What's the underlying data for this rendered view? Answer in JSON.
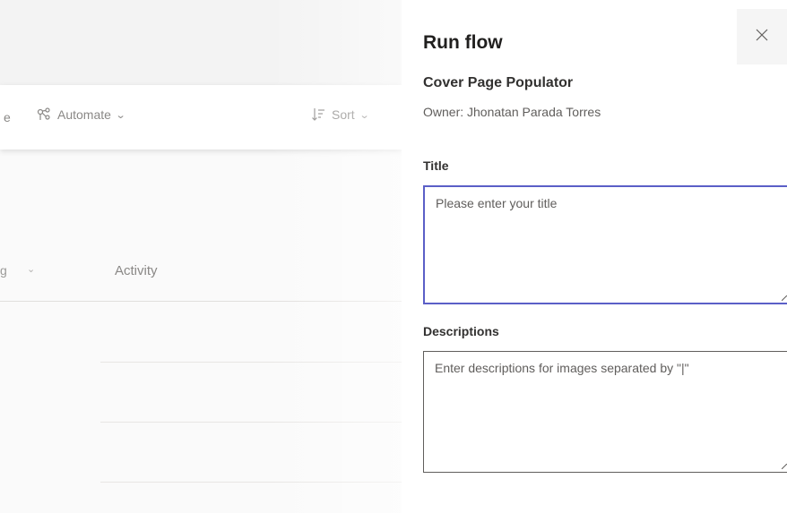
{
  "toolbar": {
    "cut_label": "e",
    "automate_label": "Automate",
    "sort_label": "Sort"
  },
  "list": {
    "cut_column": "g",
    "activity_column": "Activity"
  },
  "panel": {
    "title": "Run flow",
    "flow_name": "Cover Page Populator",
    "owner": "Owner: Jhonatan Parada Torres",
    "fields": {
      "title_label": "Title",
      "title_placeholder": "Please enter your title",
      "descriptions_label": "Descriptions",
      "descriptions_placeholder": "Enter descriptions for images separated by \"|\""
    }
  },
  "colors": {
    "focus_border": "#5b5fc7",
    "panel_bg": "#ffffff",
    "page_bg": "#fafafa"
  },
  "icons": [
    "automate-icon",
    "sort-icon",
    "chevron-down-icon",
    "close-icon"
  ]
}
